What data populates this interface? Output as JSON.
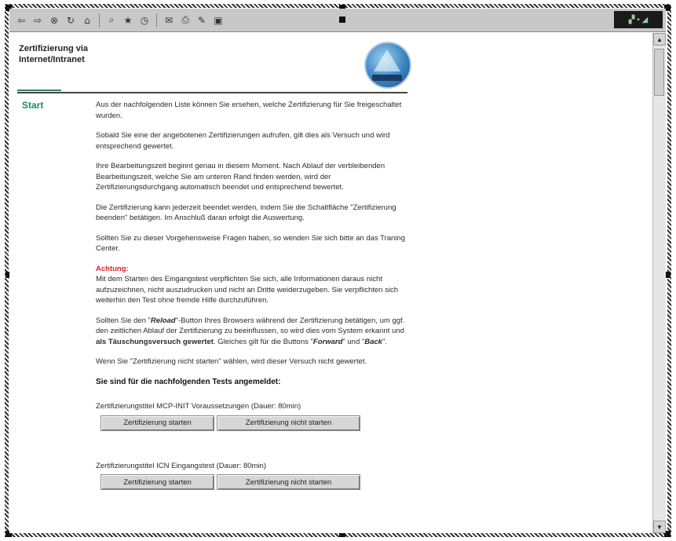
{
  "toolbar": {
    "icons": [
      "back-icon",
      "forward-icon",
      "stop-icon",
      "refresh-icon",
      "home-icon",
      "search-icon",
      "favorites-icon",
      "history-icon",
      "mail-icon",
      "print-icon",
      "edit-icon",
      "discuss-icon"
    ],
    "glyphs": {
      "back": "⇦",
      "forward": "⇨",
      "stop": "⊗",
      "refresh": "↻",
      "home": "⌂",
      "search": "⌕",
      "favorites": "★",
      "history": "◷",
      "mail": "✉",
      "print": "⎙",
      "edit": "✎",
      "discuss": "▣"
    }
  },
  "header": {
    "title": "Zertifizierung via\nInternet/Intranet"
  },
  "nav": {
    "start": "Start"
  },
  "content": {
    "p1": "Aus der nachfolgenden Liste können Sie ersehen, welche Zertifizierung für Sie freigeschaltet wurden.",
    "p2": "Sobald Sie eine der angebotenen Zertifizierungen aufrufen, gilt dies als Versuch und wird entsprechend gewertet.",
    "p3": "Ihre Bearbeitungszeit beginnt genau in diesem Moment. Nach Ablauf der verbleibenden Bearbeitungszeit, welche Sie am unteren Rand finden werden, wird der Zertifizierungsdurchgang automatisch beendet und entsprechend bewertet.",
    "p4": "Die Zertifizierung kann jederzeit beendet werden, indem Sie die Schaltfläche \"Zertifizierung beenden\" betätigen. Im Anschluß daran erfolgt die Auswertung.",
    "p5": "Sollten Sie zu dieser Vorgehensweise Fragen haben, so wenden Sie sich bitte an das Traning Center.",
    "warning_label": "Achtung:",
    "warning_text": "Mit dem Starten des Eingangstest verpflichten Sie sich, alle Informationen daraus nicht aufzuzeichnen, nicht auszudrucken und nicht an Dritte weiderzugeben. Sie verpflichten sich weiterhin den Test ohne fremde Hilfe durchzuführen.",
    "p6_a": "Sollten Sie den \"",
    "p6_reload": "Reload",
    "p6_b": "\"-Button Ihres Browsers während der Zertifizierung betätigen, um ggf. den zeitlichen Ablauf der Zertifizierung zu beeinflussen, so wird dies vom System erkannt und ",
    "p6_bold": "als Täuschungsversuch gewertet",
    "p6_c": ". Gleiches gilt für die Buttons \"",
    "p6_forward": "Forward",
    "p6_d": "\" und \"",
    "p6_back": "Back",
    "p6_e": "\".",
    "p7": "Wenn Sie \"Zertifizierung nicht starten\" wählen, wird dieser Versuch nicht gewertet.",
    "registered_heading": "Sie sind für die nachfolgenden Tests angemeldet:"
  },
  "tests": [
    {
      "title": "Zertifizierungstitel MCP-INIT Voraussetzungen (Dauer: 80min)",
      "start_label": "Zertifizierung starten",
      "nostart_label": "Zertifizierung nicht starten"
    },
    {
      "title": "Zertifizierungstitel ICN Eingangstest (Dauer: 80min)",
      "start_label": "Zertifizierung starten",
      "nostart_label": "Zertifizierung nicht starten"
    }
  ],
  "colors": {
    "accent_green": "#1f8a6b",
    "warning_red": "#e0202e"
  }
}
